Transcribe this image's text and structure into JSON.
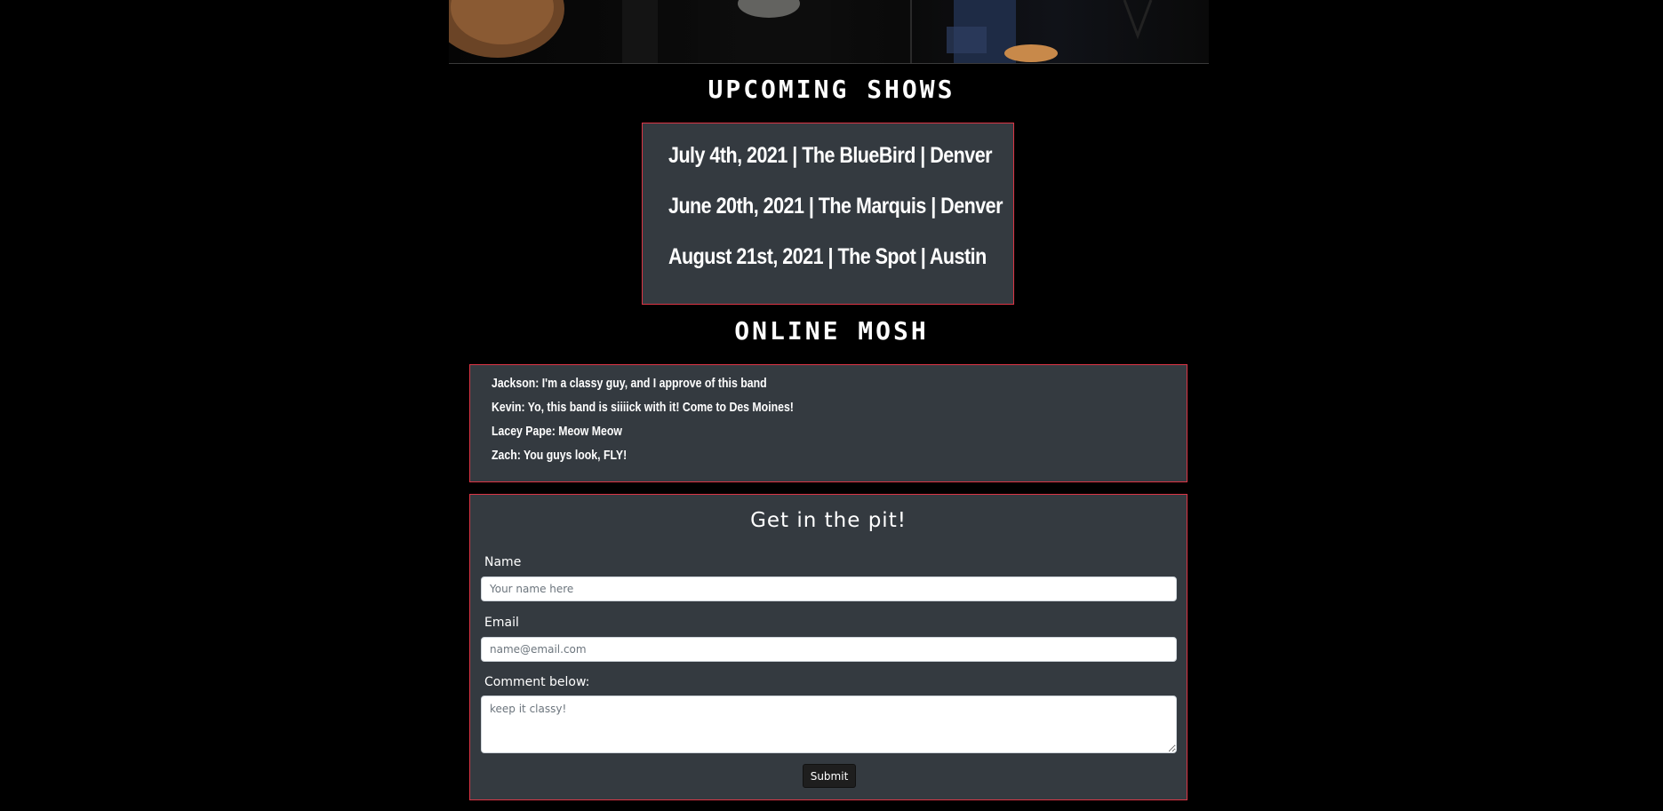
{
  "hero": {
    "alt": "band photo"
  },
  "shows": {
    "title": "UPCOMING SHOWS",
    "items": [
      "July 4th, 2021 | The BlueBird | Denver",
      "June 20th, 2021 | The Marquis | Denver",
      "August 21st, 2021 | The Spot | Austin"
    ]
  },
  "mosh": {
    "title": "ONLINE MOSH",
    "comments": [
      "Jackson: I'm a classy guy, and I approve of this band",
      "Kevin: Yo, this band is siiiick with it! Come to Des Moines!",
      "Lacey Pape: Meow Meow",
      "Zach: You guys look, FLY!"
    ]
  },
  "form": {
    "title": "Get in the pit!",
    "name_label": "Name",
    "name_placeholder": "Your name here",
    "email_label": "Email",
    "email_placeholder": "name@email.com",
    "comment_label": "Comment below:",
    "comment_placeholder": "keep it classy!",
    "submit_label": "Submit"
  },
  "colors": {
    "background": "#000000",
    "panel": "#343a40",
    "border_accent": "#dc3545",
    "text": "#ffffff"
  }
}
